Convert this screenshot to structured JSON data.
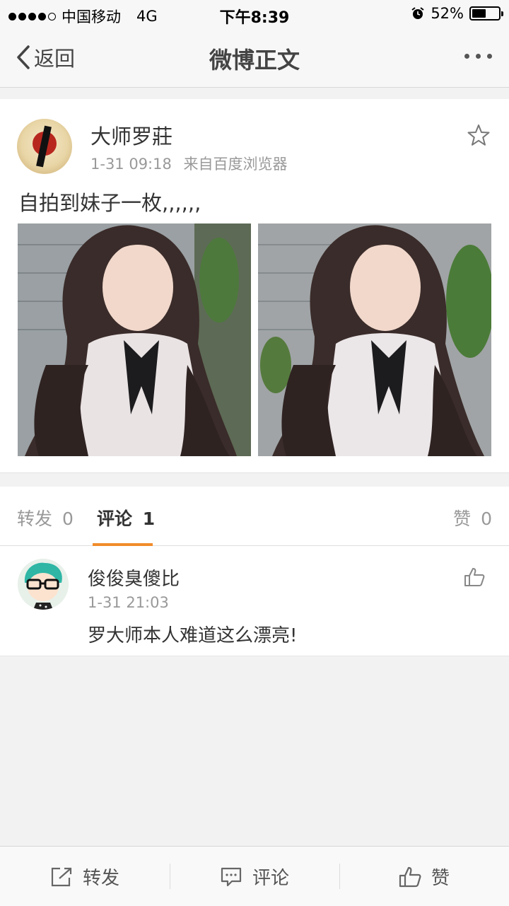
{
  "status_bar": {
    "carrier": "中国移动",
    "network": "4G",
    "time": "下午8:39",
    "battery_percent": "52%",
    "battery_level": 0.52,
    "signal_bars_filled": 4,
    "signal_bars_total": 5
  },
  "nav": {
    "back_label": "返回",
    "title": "微博正文"
  },
  "post": {
    "username": "大师罗莊",
    "timestamp": "1-31 09:18",
    "source": "来自百度浏览器",
    "text": "自拍到妹子一枚,,,,,,",
    "image_count": 2
  },
  "tabs": {
    "repost_label": "转发",
    "repost_count": "0",
    "comment_label": "评论",
    "comment_count": "1",
    "like_label": "赞",
    "like_count": "0"
  },
  "comments": [
    {
      "username": "俊俊臭傻比",
      "timestamp": "1-31 21:03",
      "text": "罗大师本人难道这么漂亮!"
    }
  ],
  "bottom_bar": {
    "repost": "转发",
    "comment": "评论",
    "like": "赞"
  },
  "colors": {
    "accent": "#f08c2a",
    "text_primary": "#333333",
    "text_secondary": "#999999",
    "background": "#f2f2f2"
  }
}
